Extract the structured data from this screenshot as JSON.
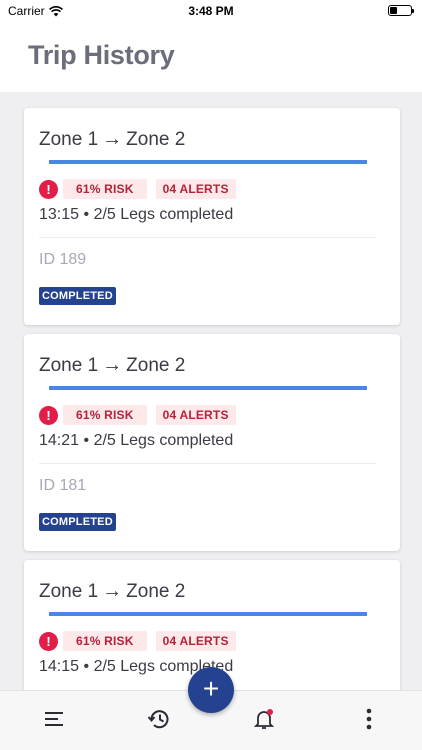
{
  "status_bar": {
    "carrier": "Carrier",
    "time": "3:48 PM"
  },
  "header": {
    "title": "Trip History"
  },
  "trips": [
    {
      "origin": "Zone 1",
      "destination": "Zone 2",
      "arrow": "→",
      "progress": 1.0,
      "risk": "61% RISK",
      "alerts": "04 ALERTS",
      "time": "13:15",
      "legs": "2/5 Legs completed",
      "id": "ID 189",
      "status": "COMPLETED"
    },
    {
      "origin": "Zone 1",
      "destination": "Zone 2",
      "arrow": "→",
      "progress": 1.0,
      "risk": "61% RISK",
      "alerts": "04 ALERTS",
      "time": "14:21",
      "legs": "2/5 Legs completed",
      "id": "ID 181",
      "status": "COMPLETED"
    },
    {
      "origin": "Zone 1",
      "destination": "Zone 2",
      "arrow": "→",
      "progress": 1.0,
      "risk": "61% RISK",
      "alerts": "04 ALERTS",
      "time": "14:15",
      "legs": "2/5 Legs completed",
      "id": "",
      "status": ""
    }
  ],
  "summary_separator": "•",
  "fab": {
    "label": "+"
  },
  "bottom_nav": [
    {
      "icon": "menu-icon"
    },
    {
      "icon": "history-icon"
    },
    {
      "icon": "notification-bell-icon"
    },
    {
      "icon": "more-vertical-icon"
    }
  ],
  "colors": {
    "accent": "#24428f",
    "progress": "#4a86e8",
    "risk_bg": "#fde8ea",
    "risk_text": "#b4233a",
    "warning": "#e11d48"
  }
}
